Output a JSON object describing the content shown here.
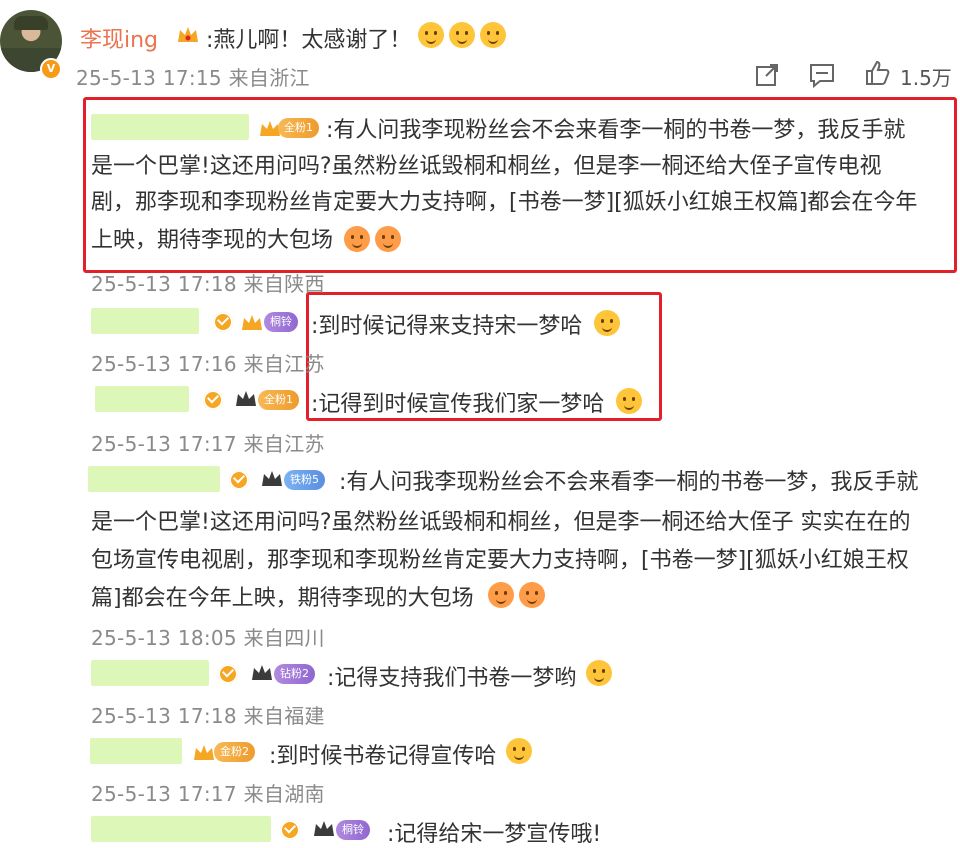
{
  "main": {
    "username": "李现ing",
    "text": ":燕儿啊！太感谢了！",
    "meta": "25-5-13 17:15 来自浙江",
    "likes": "1.5万"
  },
  "replies": [
    {
      "badge": "全粉1",
      "lines": [
        ":有人问我李现粉丝会不会来看李一桐的书卷一梦，我反手就",
        "是一个巴掌!这还用问吗?虽然粉丝诋毁桐和桐丝，但是李一桐还给大侄子宣传电视",
        "剧，那李现和李现粉丝肯定要大力支持啊，[书卷一梦][狐妖小红娘王权篇]都会在今年",
        "上映，期待李现的大包场"
      ],
      "meta": "25-5-13 17:18 来自陕西"
    },
    {
      "badge": "桐铃",
      "text": ":到时候记得来支持宋一梦哈",
      "meta": "25-5-13 17:16 来自江苏"
    },
    {
      "badge": "全粉1",
      "text": ":记得到时候宣传我们家一梦哈",
      "meta": "25-5-13 17:17 来自江苏"
    },
    {
      "badge": "铁粉5",
      "lines": [
        ":有人问我李现粉丝会不会来看李一桐的书卷一梦，我反手就",
        "是一个巴掌!这还用问吗?虽然粉丝诋毁桐和桐丝，但是李一桐还给大侄子 实实在在的",
        "包场宣传电视剧，那李现和李现粉丝肯定要大力支持啊，[书卷一梦][狐妖小红娘王权",
        "篇]都会在今年上映，期待李现的大包场"
      ],
      "meta": "25-5-13 18:05 来自四川"
    },
    {
      "badge": "钻粉2",
      "text": ":记得支持我们书卷一梦哟",
      "meta": "25-5-13 17:18 来自福建"
    },
    {
      "badge": "金粉2",
      "text": ":到时候书卷记得宣传哈",
      "meta": "25-5-13 17:17 来自湖南"
    },
    {
      "badge": "桐铃",
      "text": ":记得给宋一梦宣传哦!"
    }
  ]
}
